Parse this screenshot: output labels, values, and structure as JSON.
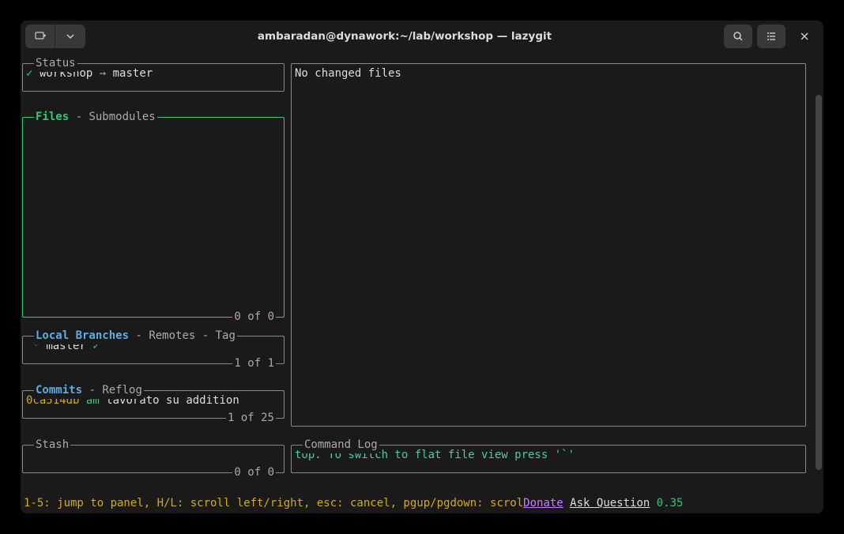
{
  "window": {
    "title": "ambaradan@dynawork:~/lab/workshop — lazygit"
  },
  "panels": {
    "status": {
      "title": "Status",
      "check": "✓",
      "repo": "workshop",
      "arrow": "→",
      "branch": "master"
    },
    "files": {
      "tab1": "Files",
      "sep1": " - ",
      "tab2": "Submodules",
      "footer": "0 of 0"
    },
    "branches": {
      "tab1": "Local Branches",
      "sep1": " - ",
      "tab2": "Remotes",
      "sep2": " - ",
      "tab3": "Tag",
      "star": "*",
      "branch": "master",
      "check": "✓",
      "footer": "1 of 1"
    },
    "commits": {
      "tab1": "Commits",
      "sep1": " - ",
      "tab2": "Reflog",
      "hash": "0ca514db",
      "author": "am",
      "msg": "lavorato su addition",
      "footer": "1 of 25"
    },
    "stash": {
      "title": "Stash",
      "footer": "0 of 0"
    },
    "main": {
      "content": "No changed files"
    },
    "cmdlog": {
      "title": "Command Log",
      "content": "top. To switch to flat file view press '`'"
    }
  },
  "statusline": {
    "hint": "1-5: jump to panel, H/L: scroll left/right, esc: cancel, pgup/pgdown: scrol",
    "donate": "Donate",
    "ask": "Ask Question",
    "version": "0.35"
  }
}
